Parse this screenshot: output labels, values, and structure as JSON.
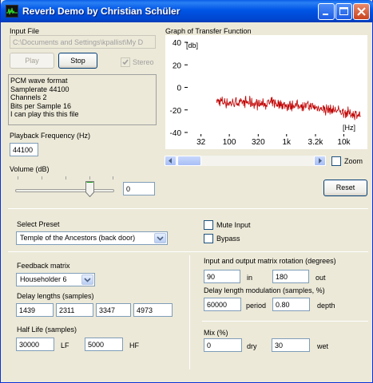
{
  "window": {
    "title": "Reverb Demo by Christian Schüler"
  },
  "input_file": {
    "label": "Input File",
    "path": "C:\\Documents and Settings\\kpallist\\My D"
  },
  "buttons": {
    "play": "Play",
    "stop": "Stop",
    "reset": "Reset"
  },
  "stereo": {
    "label": "Stereo",
    "checked": true,
    "enabled": false
  },
  "file_info": [
    "PCM wave format",
    "Samplerate 44100",
    "Channels 2",
    "Bits per Sample 16",
    "I can play this this file"
  ],
  "playback": {
    "label": "Playback Frequency (Hz)",
    "value": "44100"
  },
  "volume": {
    "label": "Volume (dB)",
    "value": "0",
    "slider_fraction": 0.73
  },
  "graph": {
    "title": "Graph of Transfer Function",
    "y_unit": "[db]",
    "x_unit": "[Hz]",
    "y_ticks": [
      "40",
      "20",
      "0",
      "-20",
      "-40"
    ],
    "x_ticks": [
      "32",
      "100",
      "320",
      "1k",
      "3.2k",
      "10k"
    ],
    "zoom_label": "Zoom",
    "zoom_checked": false,
    "line_color": "#c00000"
  },
  "chart_data": {
    "type": "line",
    "title": "Graph of Transfer Function",
    "xlabel": "[Hz]",
    "ylabel": "[db]",
    "xscale": "log",
    "ylim": [
      -40,
      40
    ],
    "xlim_ticks": [
      "32",
      "100",
      "320",
      "1k",
      "3.2k",
      "10k"
    ],
    "series": [
      {
        "values_summary": "noisy response around -15 dB from ~60 Hz to ~22 kHz, gradually declining toward -25 dB at high frequency",
        "x": [
          60,
          100,
          200,
          320,
          600,
          1000,
          2000,
          3200,
          6000,
          10000,
          20000
        ],
        "y": [
          -12,
          -14,
          -13,
          -15,
          -14,
          -16,
          -16,
          -18,
          -20,
          -22,
          -25
        ]
      }
    ]
  },
  "preset": {
    "label": "Select Preset",
    "value": "Temple of the Ancestors (back door)"
  },
  "mute_input": {
    "label": "Mute Input",
    "checked": false
  },
  "bypass": {
    "label": "Bypass",
    "checked": false
  },
  "feedback": {
    "label": "Feedback matrix",
    "value": "Householder 6"
  },
  "delay": {
    "label": "Delay lengths (samples)",
    "values": [
      "1439",
      "2311",
      "3347",
      "4973"
    ]
  },
  "half_life": {
    "label": "Half Life (samples)",
    "lf_value": "30000",
    "lf_label": "LF",
    "hf_value": "5000",
    "hf_label": "HF"
  },
  "rotation": {
    "label": "Input and output matrix rotation (degrees)",
    "in_value": "90",
    "in_label": "in",
    "out_value": "180",
    "out_label": "out"
  },
  "modulation": {
    "label": "Delay length modulation (samples, %)",
    "period_value": "60000",
    "period_label": "period",
    "depth_value": "0.80",
    "depth_label": "depth"
  },
  "mix": {
    "label": "Mix (%)",
    "dry_value": "0",
    "dry_label": "dry",
    "wet_value": "30",
    "wet_label": "wet"
  }
}
